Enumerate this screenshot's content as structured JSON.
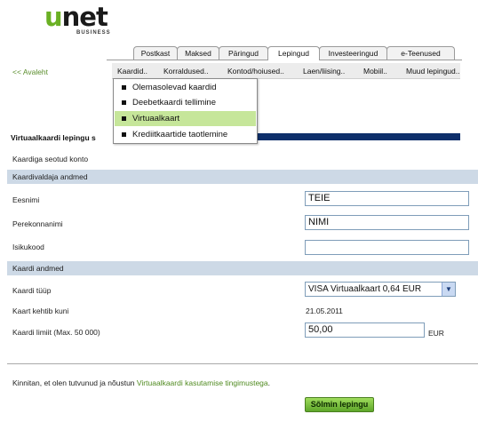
{
  "logo": {
    "brand_u": "u",
    "brand_net": "net",
    "subtitle": "BUSINESS"
  },
  "tabs": [
    {
      "label": "Postkast",
      "active": false
    },
    {
      "label": "Maksed",
      "active": false
    },
    {
      "label": "Päringud",
      "active": false
    },
    {
      "label": "Lepingud",
      "active": true
    },
    {
      "label": "Investeeringud",
      "active": false
    },
    {
      "label": "e-Teenused",
      "active": false
    }
  ],
  "back_link": "<< Avaleht",
  "subnav": [
    "Kaardid..",
    "Korraldused..",
    "Kontod/hoiused..",
    "Laen/liising..",
    "Mobiil..",
    "Muud lepingud.."
  ],
  "dropdown": [
    {
      "label": "Olemasolevad kaardid",
      "highlighted": false
    },
    {
      "label": "Deebetkaardi tellimine",
      "highlighted": false
    },
    {
      "label": "Virtuaalkaart",
      "highlighted": true
    },
    {
      "label": "Krediitkaartide taotlemine",
      "highlighted": false
    }
  ],
  "page_title": "Virtuaalkaardi lepingu s",
  "linked_account_label": "Kaardiga seotud konto",
  "holder_section": "Kaardivaldaja andmed",
  "first_name": {
    "label": "Eesnimi",
    "value": "TEIE"
  },
  "last_name": {
    "label": "Perekonnanimi",
    "value": "NIMI"
  },
  "personal_code": {
    "label": "Isikukood",
    "value": ""
  },
  "card_section": "Kaardi andmed",
  "card_type": {
    "label": "Kaardi tüüp",
    "value": "VISA Virtuaalkaart 0,64 EUR"
  },
  "valid_until": {
    "label": "Kaart kehtib kuni",
    "value": "21.05.2011"
  },
  "card_limit": {
    "label": "Kaardi limiit (Max. 50 000)",
    "value": "50,00",
    "unit": "EUR"
  },
  "confirm": {
    "prefix": "Kinnitan, et olen tutvunud ja nõustun",
    "link": "Virtuaalkaardi kasutamise tingimustega",
    "suffix": "."
  },
  "submit_label": "Sõlmin lepingu",
  "colors": {
    "accent_green": "#6ab023",
    "title_bar": "#0e2f6b",
    "section_bg": "#cdd9e6",
    "highlight": "#c6e69a"
  }
}
